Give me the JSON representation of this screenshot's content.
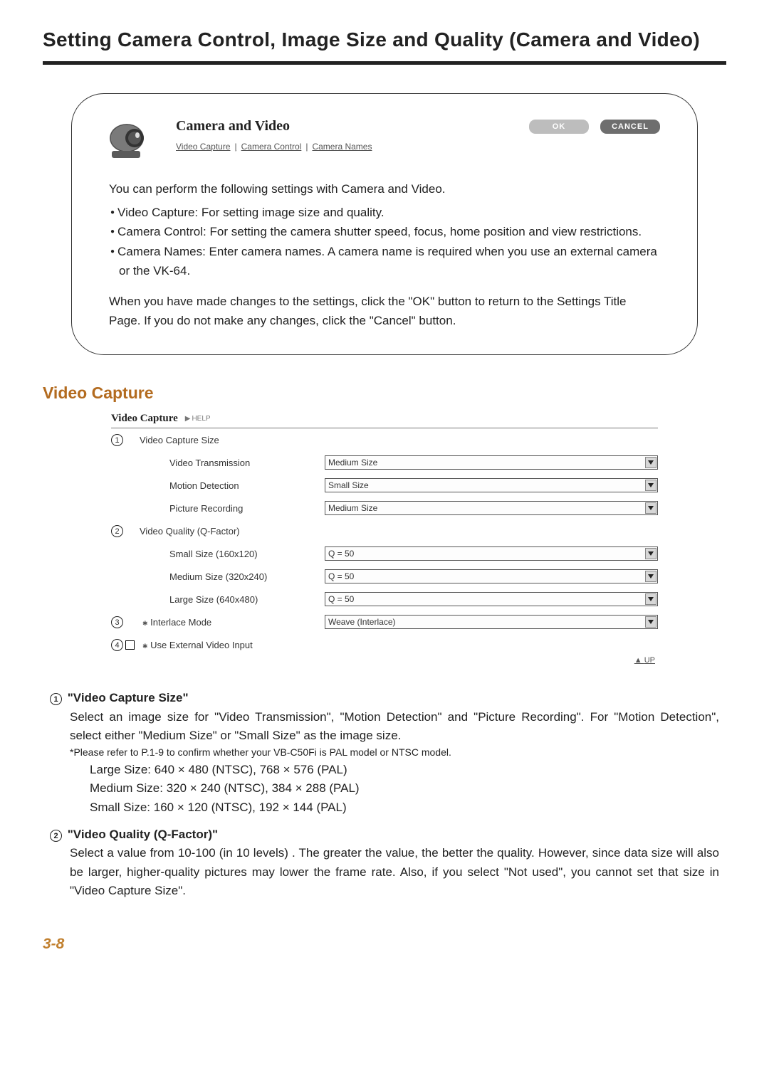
{
  "page": {
    "title": "Setting Camera Control, Image Size and Quality (Camera and Video)",
    "number": "3-8"
  },
  "card": {
    "title": "Camera and Video",
    "links": {
      "l1": "Video Capture",
      "l2": "Camera Control",
      "l3": "Camera Names"
    },
    "buttons": {
      "ok": "OK",
      "cancel": "CANCEL"
    },
    "intro": "You can perform the following settings with Camera and Video.",
    "bullets": {
      "b1": "Video Capture: For setting image size and quality.",
      "b2": "Camera Control: For setting the camera shutter speed, focus, home position and view restrictions.",
      "b3": "Camera Names: Enter camera names. A camera name is required when you use an external camera or the VK-64."
    },
    "outro": "When you have made changes to the settings, click the \"OK\" button to return to the Settings Title Page. If you do not make any changes, click the \"Cancel\" button."
  },
  "vcap": {
    "section_title": "Video Capture",
    "panel_title": "Video Capture",
    "help": "HELP",
    "group1": "Video Capture Size",
    "row_trans": "Video Transmission",
    "row_trans_val": "Medium Size",
    "row_motion": "Motion Detection",
    "row_motion_val": "Small Size",
    "row_rec": "Picture Recording",
    "row_rec_val": "Medium Size",
    "group2": "Video Quality (Q-Factor)",
    "row_s": "Small Size (160x120)",
    "row_s_val": "Q = 50",
    "row_m": "Medium Size (320x240)",
    "row_m_val": "Q = 50",
    "row_l": "Large Size (640x480)",
    "row_l_val": "Q = 50",
    "group3": "Interlace Mode",
    "group3_val": "Weave (Interlace)",
    "group4": "Use External Video Input",
    "up": "UP"
  },
  "desc1": {
    "num": "1",
    "title": "\"Video Capture Size\"",
    "p1": "Select an image size for \"Video Transmission\", \"Motion Detection\" and \"Picture Recording\". For \"Motion Detection\", select either \"Medium Size\" or \"Small Size\" as the image size.",
    "foot": "*Please refer to P.1-9 to confirm whether your VB-C50Fi is PAL model or NTSC model.",
    "s1": "Large Size: 640 × 480 (NTSC), 768 × 576 (PAL)",
    "s2": "Medium Size: 320 × 240 (NTSC), 384 × 288 (PAL)",
    "s3": "Small Size: 160 × 120 (NTSC), 192 × 144 (PAL)"
  },
  "desc2": {
    "num": "2",
    "title": "\"Video Quality (Q-Factor)\"",
    "p1": "Select a value from 10-100 (in 10 levels) . The greater the value, the better the quality. However, since data size will also be larger, higher-quality pictures may lower the frame rate. Also, if you select \"Not used\", you cannot set that size in \"Video Capture Size\"."
  }
}
